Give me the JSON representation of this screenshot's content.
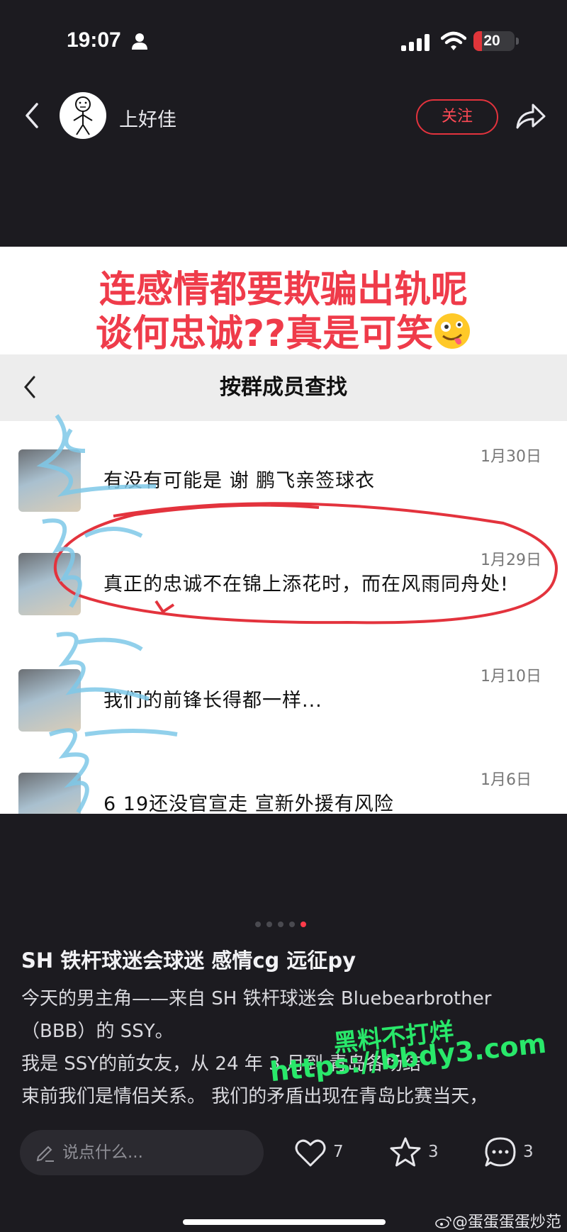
{
  "status_bar": {
    "time": "19:07",
    "battery": 20,
    "battery_label": "20"
  },
  "header": {
    "author": "上好佳",
    "follow_label": "关注"
  },
  "image": {
    "headline_line1": "连感情都要欺骗出轨呢",
    "headline_line2": "谈何忠诚??真是可笑",
    "chat_title": "按群成员查找",
    "messages": [
      {
        "date": "1月30日",
        "text": "有没有可能是 谢 鹏飞亲签球衣"
      },
      {
        "date": "1月29日",
        "text": "真正的忠诚不在锦上添花时，而在风雨同舟处!"
      },
      {
        "date": "1月10日",
        "text": "我们的前锋长得都一样..."
      },
      {
        "date": "1月6日",
        "text": "6 19还没官宣走 宣新外援有风险"
      }
    ]
  },
  "carousel": {
    "count": 5,
    "active": 5
  },
  "post": {
    "title": "SH 铁杆球迷会球迷  感情cg 远征py",
    "body_line1": "今天的男主角——来自 SH 铁杆球迷会 Bluebearbrother",
    "body_line2": "（BBB）的 SSY。",
    "body_line3": "我是 SSY的前女友，从 24 年 3 月到          青岛各场结",
    "body_line4": "束前我们是情侣关系。 我们的矛盾出现在青岛比赛当天，"
  },
  "watermark": {
    "line1": "黑料不打烊",
    "line2": "https://bbdy3.com"
  },
  "bottom_bar": {
    "placeholder": "说点什么...",
    "likes": "7",
    "favorites": "3",
    "comments": "3",
    "credit": "@蛋蛋蛋蛋炒范"
  },
  "colors": {
    "accent": "#ef3b4a",
    "background": "#1c1b20",
    "watermark": "#29e86a",
    "circle": "#e3333d",
    "scribble": "#7ec8e8"
  },
  "icons": [
    "person-icon",
    "signal-icon",
    "wifi-icon",
    "back-icon",
    "share-icon",
    "emoji-icon",
    "pencil-icon",
    "heart-icon",
    "star-icon",
    "comment-icon",
    "weibo-icon"
  ]
}
